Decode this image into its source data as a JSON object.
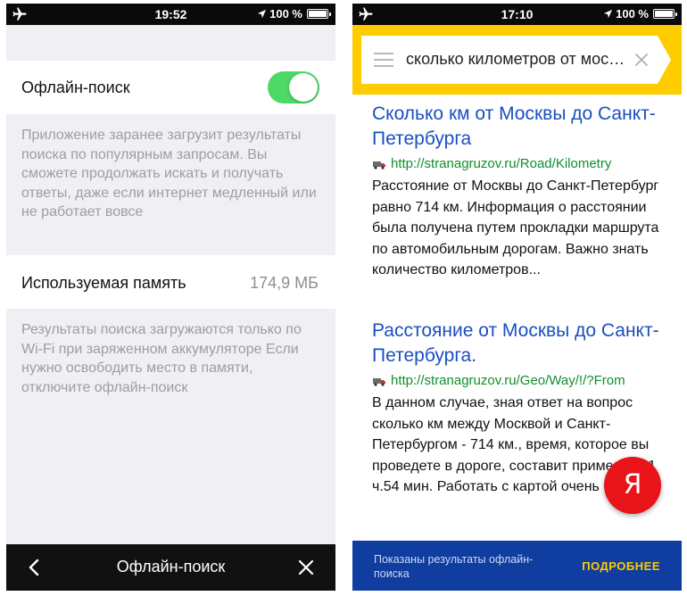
{
  "left_screen": {
    "status_bar": {
      "time": "19:52",
      "battery": "100 %"
    },
    "offline_search": {
      "label": "Офлайн-поиск",
      "enabled": true
    },
    "offline_note": "Приложение заранее загрузит результаты поиска по популярным запросам. Вы сможете продолжать искать и получать ответы, даже если интернет медленный или не работает вовсе",
    "memory": {
      "label": "Используемая память",
      "value": "174,9 МБ"
    },
    "memory_note": "Результаты поиска загружаются только по Wi-Fi при заряженном аккумуляторе Если нужно освободить место в памяти, отключите офлайн-поиск",
    "bottom_bar": {
      "title": "Офлайн-поиск"
    }
  },
  "right_screen": {
    "status_bar": {
      "time": "17:10",
      "battery": "100 %"
    },
    "search": {
      "query": "сколько километров от москвы до санкт-петербурга"
    },
    "results": [
      {
        "title": "Сколько км от Москвы до Санкт-Петербурга",
        "url": "http://stranagruzov.ru/Road/Kilometry",
        "snippet": "Расстояние от Москвы до Санкт-Петербург равно 714 км. Информация о расстоянии была получена путем прокладки маршрута по автомобильным дорогам. Важно знать количество километров..."
      },
      {
        "title": "Расстояние от Москвы до Санкт-Петербурга.",
        "url": "http://stranagruzov.ru/Geo/Way/!/?From",
        "snippet": "В данном случае, зная ответ на вопрос сколько км между Москвой и Санкт-Петербургом - 714 км., время, которое вы проведете в дороге, составит примерно 11 ч.54 мин. Работать с картой очень просто."
      }
    ],
    "fab_letter": "Я",
    "banner": {
      "text": "Показаны результаты офлайн-поиска",
      "more": "ПОДРОБНЕЕ"
    }
  },
  "colors": {
    "toggle_on": "#4cd964",
    "search_bar": "#ffcc00",
    "link": "#1a4fbf",
    "url": "#0f8f2a",
    "banner": "#0f3da0",
    "fab": "#e8141a"
  }
}
